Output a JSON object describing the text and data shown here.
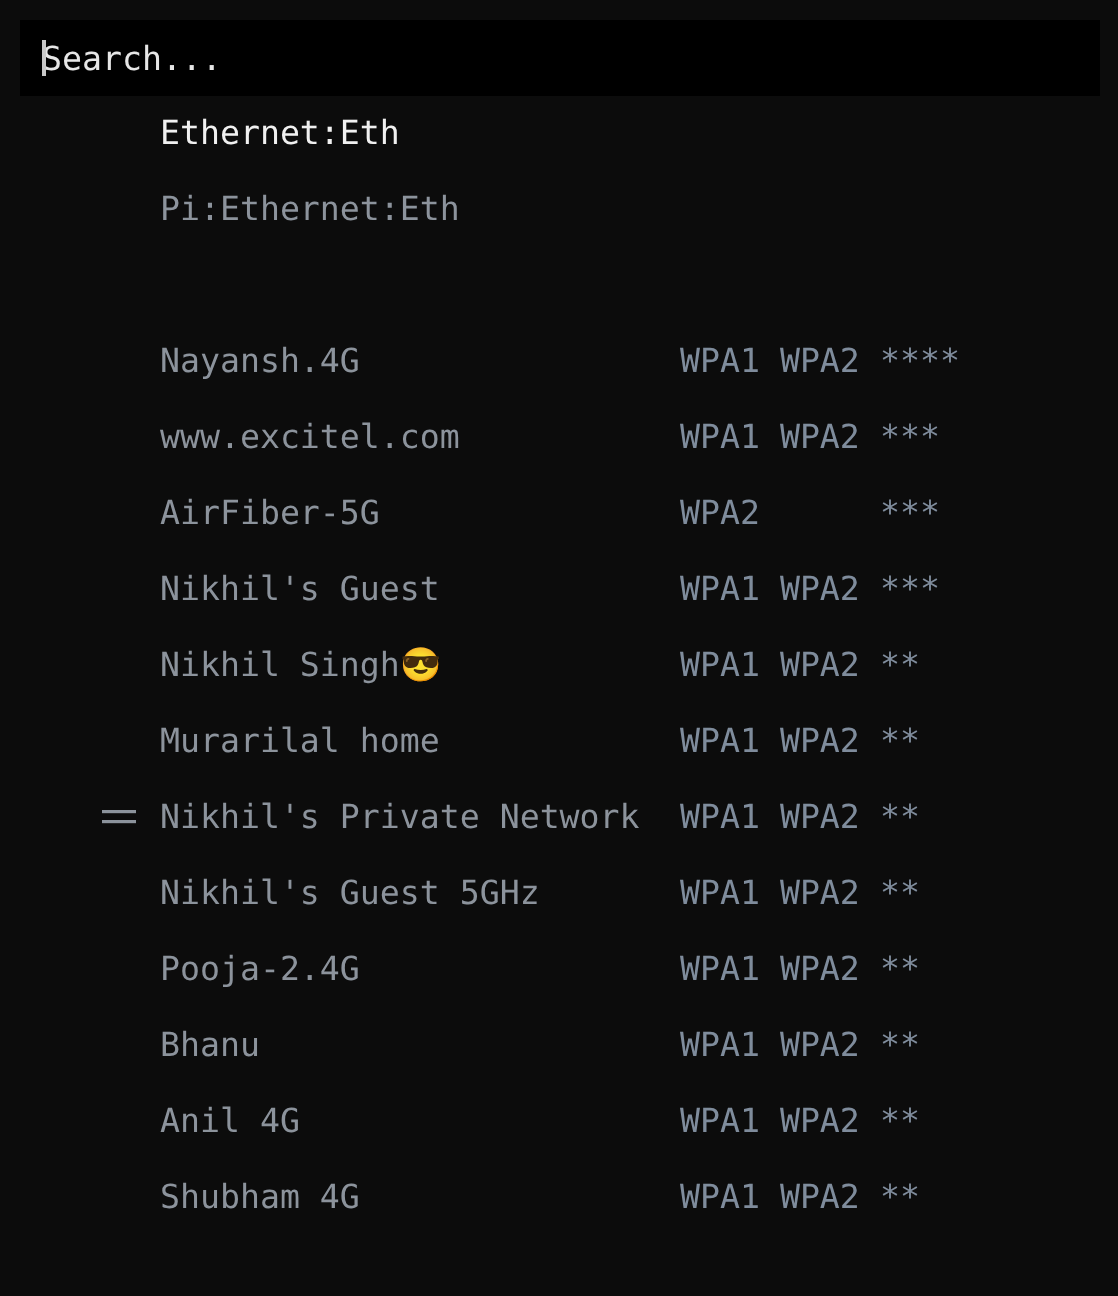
{
  "search": {
    "placeholder": "Search..."
  },
  "wired": [
    {
      "label": "Ethernet:Eth",
      "connected": true
    },
    {
      "label": "Pi:Ethernet:Eth",
      "connected": false
    }
  ],
  "networks": [
    {
      "ssid": "Nayansh.4G",
      "security": "WPA1 WPA2",
      "signal": "****",
      "selected": false
    },
    {
      "ssid": "www.excitel.com",
      "security": "WPA1 WPA2",
      "signal": "***",
      "selected": false
    },
    {
      "ssid": "AirFiber-5G",
      "security": "WPA2",
      "signal": "***",
      "selected": false
    },
    {
      "ssid": "Nikhil's Guest",
      "security": "WPA1 WPA2",
      "signal": "***",
      "selected": false
    },
    {
      "ssid": "Nikhil Singh😎",
      "security": "WPA1 WPA2",
      "signal": "**",
      "selected": false
    },
    {
      "ssid": "Murarilal home",
      "security": "WPA1 WPA2",
      "signal": "**",
      "selected": false
    },
    {
      "ssid": "Nikhil's Private Network",
      "security": "WPA1 WPA2",
      "signal": "**",
      "selected": true
    },
    {
      "ssid": "Nikhil's Guest 5GHz",
      "security": "WPA1 WPA2",
      "signal": "**",
      "selected": false
    },
    {
      "ssid": "Pooja-2.4G",
      "security": "WPA1 WPA2",
      "signal": "**",
      "selected": false
    },
    {
      "ssid": "Bhanu",
      "security": "WPA1 WPA2",
      "signal": "**",
      "selected": false
    },
    {
      "ssid": "Anil 4G",
      "security": "WPA1 WPA2",
      "signal": "**",
      "selected": false
    },
    {
      "ssid": "Shubham 4G",
      "security": "WPA1 WPA2",
      "signal": "**",
      "selected": false
    }
  ]
}
